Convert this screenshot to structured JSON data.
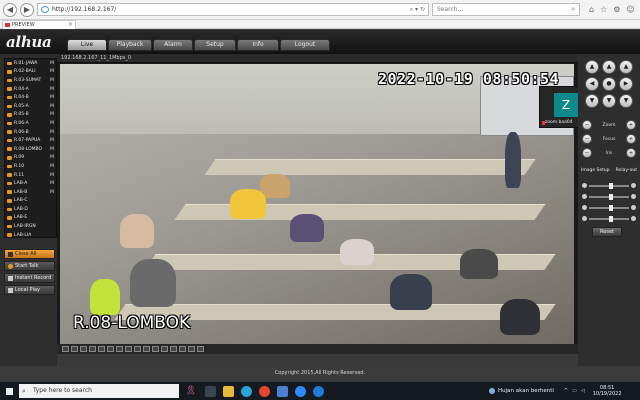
{
  "browser": {
    "url": "http://192.168.2.167/",
    "search_placeholder": "Search...",
    "tab_title": "PREVIEW"
  },
  "app": {
    "logo": "alhua",
    "tabs": [
      "Live",
      "Playback",
      "Alarm",
      "Setup",
      "Info",
      "Logout"
    ],
    "active_tab": "Live"
  },
  "channels": [
    {
      "name": "R.01-JAWA",
      "mark": "M"
    },
    {
      "name": "R.02-BALI",
      "mark": "M"
    },
    {
      "name": "R.03-SUMAT",
      "mark": "M"
    },
    {
      "name": "R.04-A",
      "mark": "M"
    },
    {
      "name": "R.04-B",
      "mark": "M"
    },
    {
      "name": "R.05-A",
      "mark": "M"
    },
    {
      "name": "R.05-B",
      "mark": "M"
    },
    {
      "name": "R.06-A",
      "mark": "M"
    },
    {
      "name": "R.06-B",
      "mark": "M"
    },
    {
      "name": "R.07-PAPUA",
      "mark": "M"
    },
    {
      "name": "R.08-LOMBO",
      "mark": "M"
    },
    {
      "name": "R.09",
      "mark": "M"
    },
    {
      "name": "R.10",
      "mark": "M"
    },
    {
      "name": "R.11",
      "mark": "M"
    },
    {
      "name": "LAB-A",
      "mark": "M"
    },
    {
      "name": "LAB-B",
      "mark": "M"
    },
    {
      "name": "LAB-C",
      "mark": ""
    },
    {
      "name": "LAB-D",
      "mark": ""
    },
    {
      "name": "LAB-E",
      "mark": ""
    },
    {
      "name": "LAB-IRGN",
      "mark": ""
    },
    {
      "name": "LAB-LIA",
      "mark": ""
    }
  ],
  "actions": {
    "close_all": "Close All",
    "start_talk": "Start Talk",
    "instant_record": "Instant Record",
    "local_play": "Local Play"
  },
  "video": {
    "header": "192.168.2.167_11_1Mbps_0",
    "timestamp": "2022-10-19 08:50:54",
    "camera_name": "R.08-LOMBOK",
    "zoom_avatar": "Z",
    "zoom_label": "zoom baa04"
  },
  "ptz": {
    "zoom_label": "Zoom",
    "focus_label": "Focus",
    "iris_label": "Iris",
    "image_setup": "Image Setup",
    "relay_out": "Relay-out",
    "reset": "Reset",
    "slider_levels": [
      0.5,
      0.5,
      0.5,
      0.5
    ]
  },
  "footer": {
    "copyright": "Copyright 2015,All Rights Reserved."
  },
  "taskbar": {
    "search_placeholder": "Type here to search",
    "weather": "Hujan akan berhenti",
    "time": "08:51",
    "date": "10/19/2022"
  }
}
